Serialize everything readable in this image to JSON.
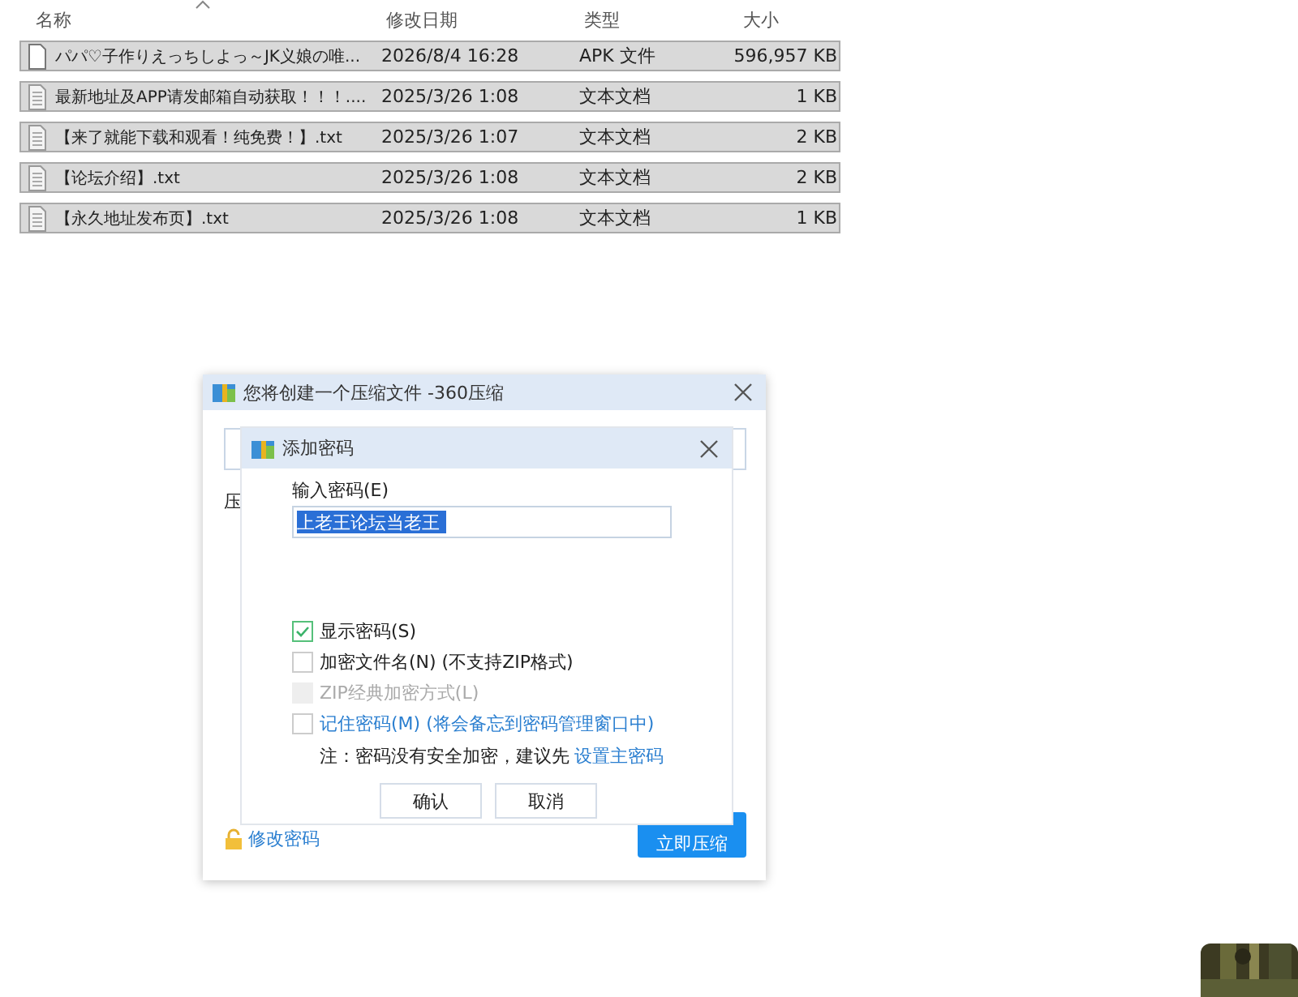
{
  "file_list": {
    "columns": [
      "名称",
      "修改日期",
      "类型",
      "大小"
    ],
    "rows": [
      {
        "name": "パパ♡子作りえっちしよっ～JK义娘の唯...",
        "modified": "2026/8/4 16:28",
        "type": "APK 文件",
        "size": "596,957 KB",
        "kind": "blank",
        "selected": true
      },
      {
        "name": "最新地址及APP请发邮箱自动获取！！！....",
        "modified": "2025/3/26 1:08",
        "type": "文本文档",
        "size": "1 KB",
        "kind": "text",
        "selected": true
      },
      {
        "name": "【来了就能下载和观看！纯免费！】.txt",
        "modified": "2025/3/26 1:07",
        "type": "文本文档",
        "size": "2 KB",
        "kind": "text",
        "selected": true
      },
      {
        "name": "【论坛介绍】.txt",
        "modified": "2025/3/26 1:08",
        "type": "文本文档",
        "size": "2 KB",
        "kind": "text",
        "selected": true
      },
      {
        "name": "【永久地址发布页】.txt",
        "modified": "2025/3/26 1:08",
        "type": "文本文档",
        "size": "1 KB",
        "kind": "text",
        "selected": true
      }
    ]
  },
  "zip_dialog": {
    "title": "您将创建一个压缩文件 -360压缩",
    "partial_label": "压",
    "link": "修改密码",
    "button": "立即压缩"
  },
  "password_dialog": {
    "title": "添加密码",
    "field_label": "输入密码(E)",
    "password": "上老王论坛当老王",
    "password_selected": true,
    "options": [
      {
        "label": "显示密码(S)",
        "checked": true,
        "disabled": false,
        "kind": "plain"
      },
      {
        "label": "加密文件名(N) (不支持ZIP格式)",
        "checked": false,
        "disabled": false,
        "kind": "plain"
      },
      {
        "label": "ZIP经典加密方式(L)",
        "checked": false,
        "disabled": true,
        "kind": "plain"
      },
      {
        "label": "记住密码(M) (将会备忘到密码管理窗口中)",
        "checked": false,
        "disabled": false,
        "kind": "link"
      }
    ],
    "note": "注：密码没有安全加密，建议先",
    "note_link": "设置主密码",
    "buttons": [
      "确认",
      "取消"
    ]
  }
}
